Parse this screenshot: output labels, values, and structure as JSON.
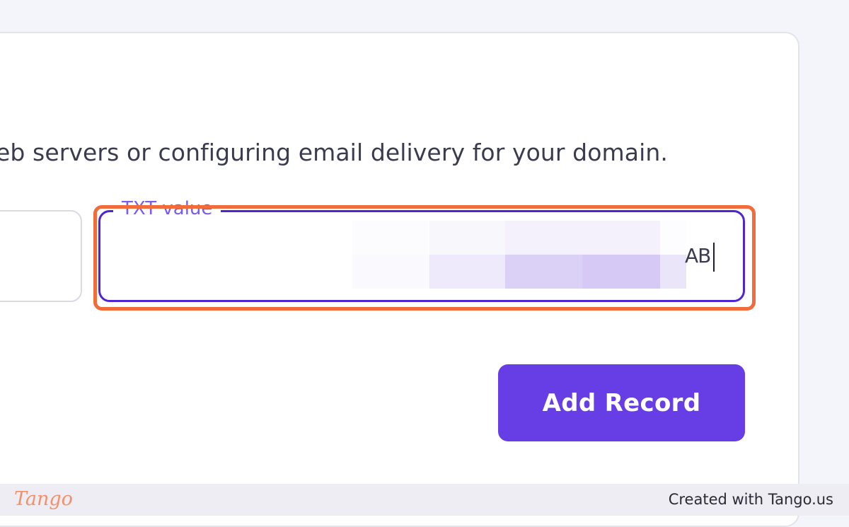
{
  "form": {
    "description": "eb servers or configuring email delivery for your domain.",
    "txt_field": {
      "label": "TXT value",
      "visible_value_end": "AB",
      "redaction_colors": [
        [
          "#fcfbfe",
          "#f8f7fc",
          "#f4f1fc",
          "#f4f1fc",
          "#fdfcfe"
        ],
        [
          "#faf9fe",
          "#eee9fb",
          "#dbd0f6",
          "#d6c9f5",
          "#ebe5fa"
        ]
      ]
    },
    "add_button_label": "Add Record"
  },
  "footer": {
    "logo": "Tango",
    "credit": "Created with Tango.us"
  },
  "colors": {
    "accent": "#673de6",
    "focus_border": "#5025d1",
    "highlight": "#f26b3a",
    "label": "#7b5cf0"
  }
}
